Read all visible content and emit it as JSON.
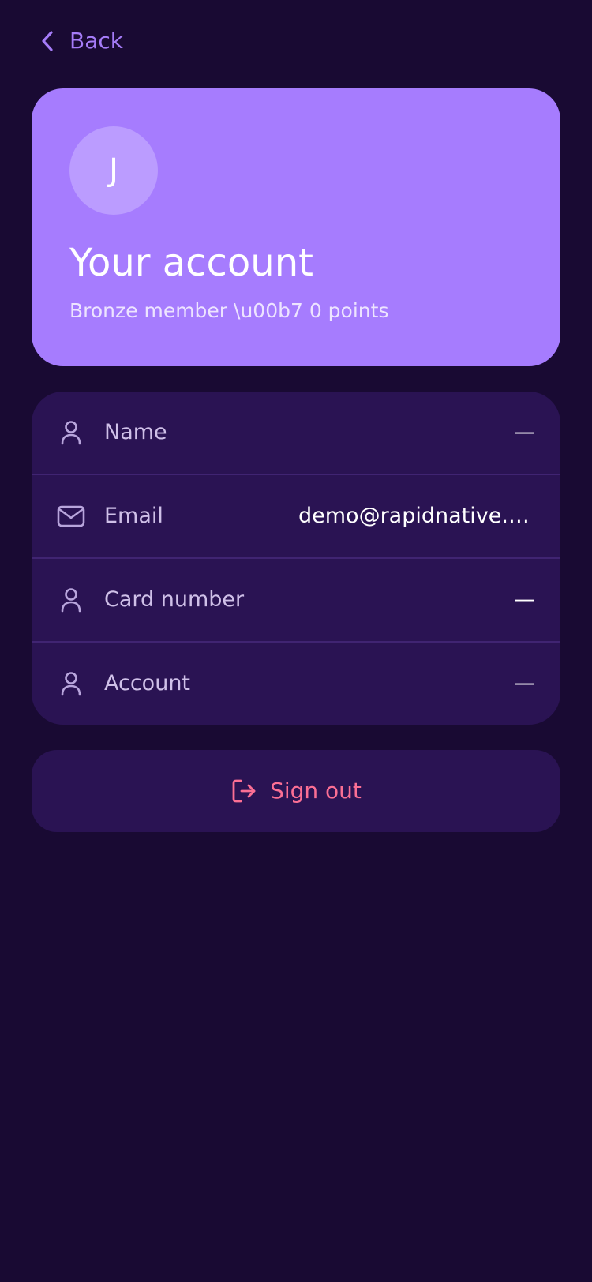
{
  "nav": {
    "back_label": "Back",
    "icon": "chevron-left-icon"
  },
  "profile": {
    "avatar_initial": "J",
    "title": "Your account",
    "subtitle": "Bronze member \\u00b7 0 points"
  },
  "details": {
    "rows": [
      {
        "icon": "user-icon",
        "label": "Name",
        "value": "—"
      },
      {
        "icon": "mail-icon",
        "label": "Email",
        "value": "demo@rapidnative.com"
      },
      {
        "icon": "user-icon",
        "label": "Card number",
        "value": "—"
      },
      {
        "icon": "user-icon",
        "label": "Account",
        "value": "—"
      }
    ]
  },
  "actions": {
    "signout_label": "Sign out",
    "signout_icon": "log-out-icon"
  },
  "colors": {
    "background": "#190a33",
    "hero": "#a67cfe",
    "card": "#2a1353",
    "accent": "#a57cf8",
    "danger": "#fb6f94"
  }
}
